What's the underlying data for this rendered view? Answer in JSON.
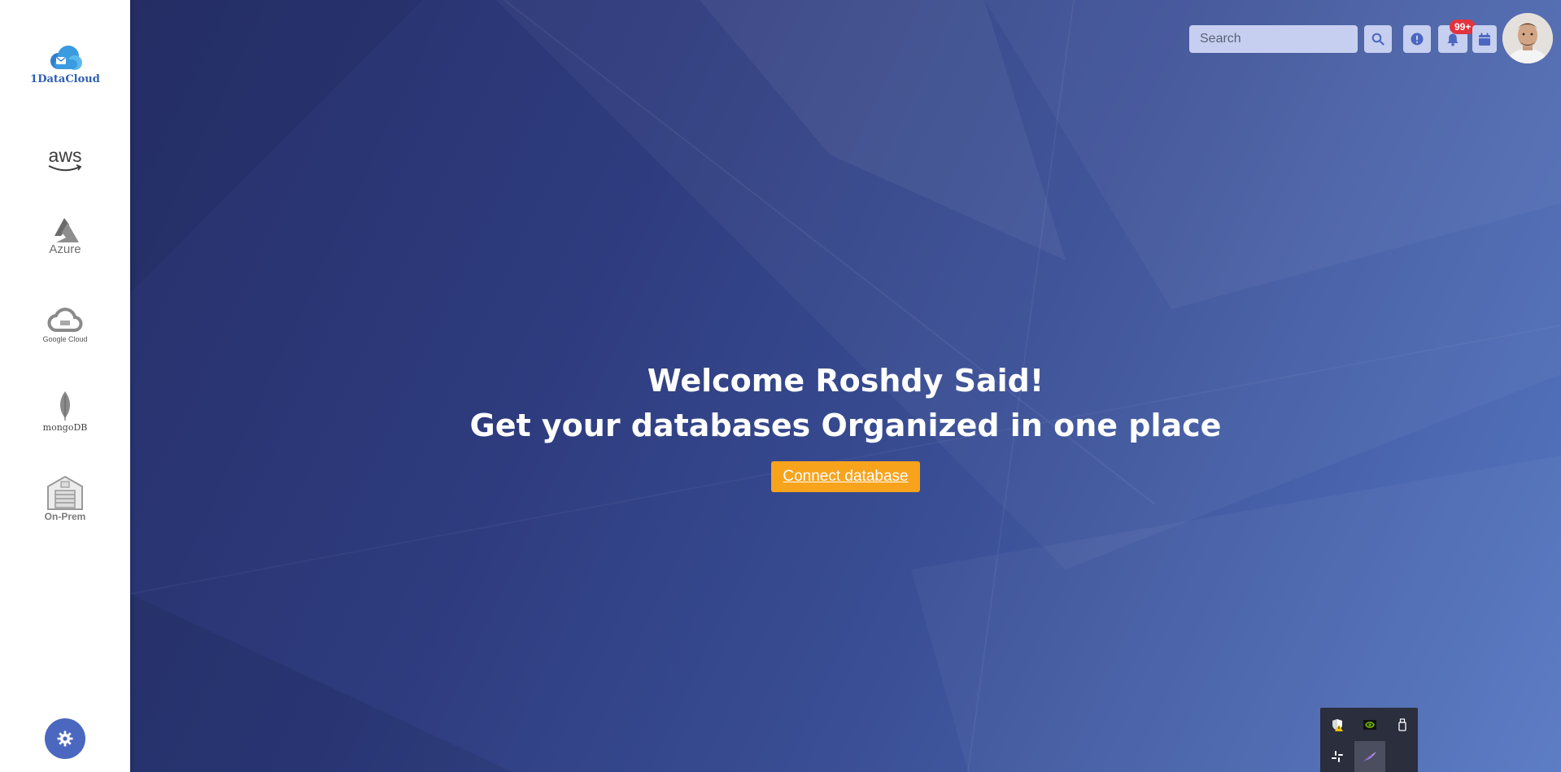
{
  "app": {
    "brand_label": "1DataCloud"
  },
  "sidebar": {
    "items": [
      {
        "id": "aws",
        "label": "aws"
      },
      {
        "id": "azure",
        "label": "Azure"
      },
      {
        "id": "google-cloud",
        "label": "Google Cloud"
      },
      {
        "id": "mongodb",
        "label": "mongoDB"
      },
      {
        "id": "on-prem",
        "label": "On-Prem"
      }
    ],
    "settings_icon": "gear-icon"
  },
  "header": {
    "search": {
      "placeholder": "Search",
      "value": ""
    },
    "buttons": [
      {
        "id": "search",
        "icon": "search-icon"
      },
      {
        "id": "info",
        "icon": "alert-icon"
      },
      {
        "id": "notifications",
        "icon": "bell-icon"
      },
      {
        "id": "calendar",
        "icon": "calendar-icon"
      }
    ],
    "notification_badge": "99+",
    "avatar": "user-avatar"
  },
  "hero": {
    "title": "Welcome Roshdy Said!",
    "subtitle": "Get your databases Organized in one place",
    "cta_label": "Connect database"
  },
  "tray": {
    "icons": [
      "security-warning-icon",
      "nvidia-icon",
      "usb-drive-icon",
      "slack-icon",
      "feather-icon"
    ]
  },
  "colors": {
    "accent": "#f8a31c",
    "primary": "#4b67bf",
    "badge": "#e0343f",
    "background_start": "#27306a",
    "background_end": "#5778c2"
  }
}
